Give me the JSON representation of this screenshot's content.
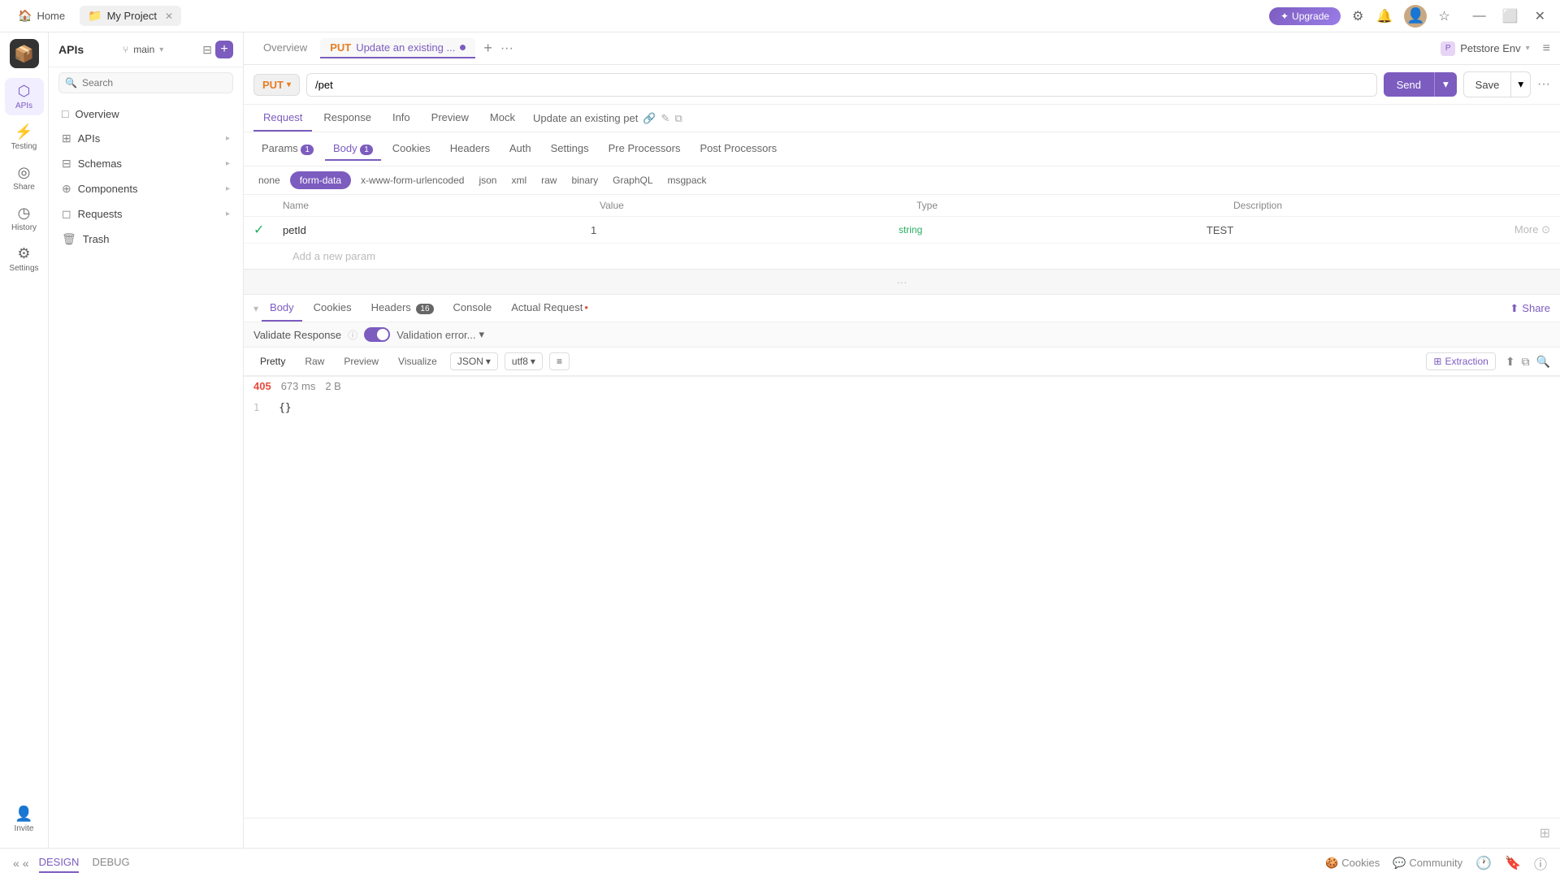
{
  "titleBar": {
    "homeLabel": "Home",
    "projectLabel": "My Project",
    "upgradeLabel": "✦ Upgrade"
  },
  "iconSidebar": {
    "items": [
      {
        "id": "apis",
        "icon": "⬡",
        "label": "APIs",
        "active": true
      },
      {
        "id": "testing",
        "icon": "⚡",
        "label": "Testing",
        "active": false
      },
      {
        "id": "share",
        "icon": "◎",
        "label": "Share",
        "active": false
      },
      {
        "id": "history",
        "icon": "◷",
        "label": "History",
        "active": false
      },
      {
        "id": "settings",
        "icon": "⚙",
        "label": "Settings",
        "active": false
      }
    ],
    "bottomItems": [
      {
        "id": "invite",
        "icon": "👤",
        "label": "Invite",
        "active": false
      }
    ]
  },
  "navSidebar": {
    "title": "APIs",
    "branchLabel": "main",
    "searchPlaceholder": "Search",
    "items": [
      {
        "id": "overview",
        "icon": "□",
        "label": "Overview",
        "hasArrow": false
      },
      {
        "id": "apis",
        "icon": "⊞",
        "label": "APIs",
        "hasArrow": true
      },
      {
        "id": "schemas",
        "icon": "⊟",
        "label": "Schemas",
        "hasArrow": true
      },
      {
        "id": "components",
        "icon": "⊕",
        "label": "Components",
        "hasArrow": true
      },
      {
        "id": "requests",
        "icon": "◻",
        "label": "Requests",
        "hasArrow": true
      },
      {
        "id": "trash",
        "icon": "🗑",
        "label": "Trash",
        "hasArrow": false
      }
    ]
  },
  "tabBar": {
    "overviewTab": "Overview",
    "activeTabPut": "PUT",
    "activeTabTitle": "Update an existing ...",
    "addTabIcon": "+",
    "moreIcon": "···"
  },
  "urlBar": {
    "method": "PUT",
    "url": "/pet",
    "sendLabel": "Send",
    "saveLabel": "Save"
  },
  "requestTabs": {
    "tabs": [
      {
        "id": "request",
        "label": "Request",
        "badge": null,
        "active": false
      },
      {
        "id": "response",
        "label": "Response",
        "badge": null,
        "active": false
      },
      {
        "id": "info",
        "label": "Info",
        "badge": null,
        "active": false
      },
      {
        "id": "preview",
        "label": "Preview",
        "badge": null,
        "active": false
      },
      {
        "id": "mock",
        "label": "Mock",
        "badge": null,
        "active": false
      }
    ],
    "breadcrumb": "Update an existing pet"
  },
  "bodyTabs": {
    "topTabs": [
      {
        "id": "params",
        "label": "Params",
        "badge": "1",
        "active": false
      },
      {
        "id": "body",
        "label": "Body",
        "badge": "1",
        "active": true
      },
      {
        "id": "cookies",
        "label": "Cookies",
        "badge": null,
        "active": false
      },
      {
        "id": "headers",
        "label": "Headers",
        "badge": null,
        "active": false
      },
      {
        "id": "auth",
        "label": "Auth",
        "badge": null,
        "active": false
      },
      {
        "id": "settings",
        "label": "Settings",
        "badge": null,
        "active": false
      },
      {
        "id": "preprocessors",
        "label": "Pre Processors",
        "badge": null,
        "active": false
      },
      {
        "id": "postprocessors",
        "label": "Post Processors",
        "badge": null,
        "active": false
      }
    ],
    "formats": [
      {
        "id": "none",
        "label": "none",
        "active": false
      },
      {
        "id": "form-data",
        "label": "form-data",
        "active": true
      },
      {
        "id": "x-www",
        "label": "x-www-form-urlencoded",
        "active": false
      },
      {
        "id": "json",
        "label": "json",
        "active": false
      },
      {
        "id": "xml",
        "label": "xml",
        "active": false
      },
      {
        "id": "raw",
        "label": "raw",
        "active": false
      },
      {
        "id": "binary",
        "label": "binary",
        "active": false
      },
      {
        "id": "graphql",
        "label": "GraphQL",
        "active": false
      },
      {
        "id": "msgpack",
        "label": "msgpack",
        "active": false
      }
    ]
  },
  "paramsTable": {
    "headers": [
      "",
      "Name",
      "Value",
      "Type",
      "Description",
      ""
    ],
    "rows": [
      {
        "checked": true,
        "name": "petId",
        "value": "1",
        "type": "string",
        "description": "TEST"
      }
    ],
    "addLabel": "Add a new param"
  },
  "responseTabs": {
    "tabs": [
      {
        "id": "body",
        "label": "Body",
        "badge": null,
        "active": true
      },
      {
        "id": "cookies",
        "label": "Cookies",
        "badge": null,
        "active": false
      },
      {
        "id": "headers",
        "label": "Headers",
        "badge": "16",
        "active": false
      },
      {
        "id": "console",
        "label": "Console",
        "badge": null,
        "active": false
      },
      {
        "id": "actual-request",
        "label": "Actual Request",
        "badge": "•",
        "active": false
      }
    ],
    "shareLabel": "Share"
  },
  "validateBar": {
    "validateLabel": "Validate Response",
    "toggleOn": true,
    "errorLabel": "Validation error...",
    "infoIcon": "ⓘ"
  },
  "formatBar": {
    "tabs": [
      {
        "id": "pretty",
        "label": "Pretty",
        "active": true
      },
      {
        "id": "raw",
        "label": "Raw",
        "active": false
      },
      {
        "id": "preview",
        "label": "Preview",
        "active": false
      },
      {
        "id": "visualize",
        "label": "Visualize",
        "active": false
      }
    ],
    "jsonFormat": "JSON",
    "encoding": "utf8",
    "extractionLabel": "Extraction"
  },
  "codeEditor": {
    "lineNumber": "1",
    "content": "{}"
  },
  "statusBar": {
    "code": "405",
    "time": "673 ms",
    "size": "2 B"
  },
  "bottomBar": {
    "tabs": [
      {
        "id": "design",
        "label": "DESIGN",
        "active": true
      },
      {
        "id": "debug",
        "label": "DEBUG",
        "active": false
      }
    ],
    "rightLinks": [
      {
        "id": "cookies",
        "icon": "🍪",
        "label": "Cookies"
      },
      {
        "id": "community",
        "icon": "💬",
        "label": "Community"
      },
      {
        "id": "clock",
        "icon": "🕐",
        "label": ""
      },
      {
        "id": "bookmark",
        "icon": "🔖",
        "label": ""
      },
      {
        "id": "info",
        "icon": "ⓘ",
        "label": ""
      }
    ]
  },
  "topRightBar": {
    "envLabel": "Petstore Env",
    "collapseIcon": "≡",
    "helpIcon": "◷"
  }
}
